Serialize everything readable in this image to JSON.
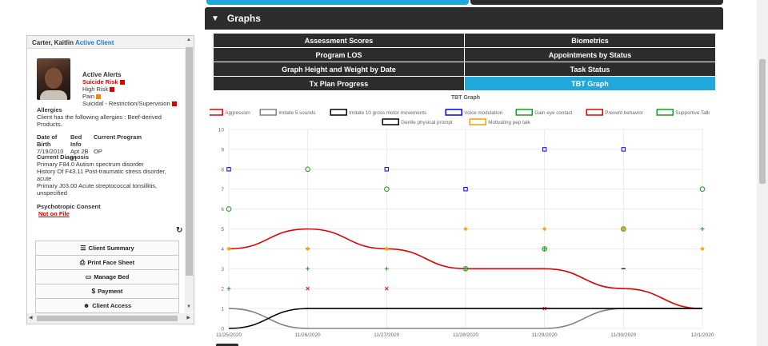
{
  "graphs_header": {
    "title": "Graphs"
  },
  "tabs": [
    {
      "label": "Assessment Scores",
      "active": false
    },
    {
      "label": "Biometrics",
      "active": false
    },
    {
      "label": "Program LOS",
      "active": false
    },
    {
      "label": "Appointments by Status",
      "active": false
    },
    {
      "label": "Graph Height and Weight by Date",
      "active": false
    },
    {
      "label": "Task Status",
      "active": false
    },
    {
      "label": "Tx Plan Progress",
      "active": false
    },
    {
      "label": "TBT Graph",
      "active": true
    }
  ],
  "client": {
    "name": "Carter, Kaitlin",
    "status": "Active Client",
    "alerts_title": "Active Alerts",
    "alerts": [
      {
        "text": "Suicide Risk",
        "color": "#e00000",
        "bold_red": true
      },
      {
        "text": "High Risk",
        "color": "#e00000",
        "bold_red": false
      },
      {
        "text": "Pain",
        "color": "#f28c00",
        "bold_red": false
      },
      {
        "text": "Suicidal - Restriction/Supervision",
        "color": "#e00000",
        "bold_red": false
      }
    ],
    "allergies_label": "Allergies",
    "allergies_text": "Client has the following allergies : Beef-derived Products.",
    "dob_label": "Date of Birth",
    "bed_label": "Bed Info",
    "program_label": "Current Program",
    "dob": "7/19/2010",
    "bed": "Apt 2B 01",
    "program": "OP",
    "diagnosis_label": "Current Diagnosis",
    "diagnosis": [
      "Primary F84.0 Autism spectrum disorder",
      "History Of F43.11 Post-traumatic stress disorder, acute",
      "Primary J03.00 Acute streptococcal tonsillitis, unspecified"
    ],
    "consent_label": "Psychotropic Consent",
    "consent_value": "Not on File"
  },
  "actions": [
    {
      "label": "Client Summary",
      "icon": "list-icon",
      "glyph": "☰"
    },
    {
      "label": "Print Face Sheet",
      "icon": "print-icon",
      "glyph": "⎙"
    },
    {
      "label": "Manage Bed",
      "icon": "bed-icon",
      "glyph": "▭"
    },
    {
      "label": "Payment",
      "icon": "dollar-icon",
      "glyph": "$"
    },
    {
      "label": "Client Access",
      "icon": "user-key-icon",
      "glyph": "☻"
    }
  ],
  "chart_data": {
    "type": "line",
    "title": "TBT Graph",
    "x": [
      "11/25/2020",
      "11/26/2020",
      "11/27/2020",
      "11/28/2020",
      "11/29/2020",
      "11/30/2020",
      "12/1/2020"
    ],
    "ylim": [
      0,
      10
    ],
    "yticks": [
      0,
      1,
      2,
      3,
      4,
      5,
      6,
      7,
      8,
      9,
      10
    ],
    "grid": true,
    "legend_position": "top",
    "series": [
      {
        "name": "Aggression",
        "color": "#e00000",
        "type": "line",
        "values": [
          4,
          5,
          4,
          3,
          3,
          2,
          1
        ]
      },
      {
        "name": "Imitate 5 sounds",
        "color": "#808080",
        "type": "line",
        "values": [
          1,
          0,
          0,
          0,
          0,
          1,
          1
        ]
      },
      {
        "name": "Imitate 10 gross motor movements",
        "color": "#000000",
        "type": "line",
        "values": [
          0,
          1,
          1,
          1,
          1,
          1,
          1
        ]
      },
      {
        "name": "Voice modulation",
        "color": "#0000ee",
        "type": "points",
        "marker": "square",
        "values": [
          8,
          null,
          8,
          7,
          9,
          9,
          null
        ]
      },
      {
        "name": "Gain eye contact",
        "color": "#1a9a1a",
        "type": "points",
        "marker": "circle",
        "values": [
          6,
          8,
          7,
          3,
          4,
          5,
          7
        ]
      },
      {
        "name": "Prevent behavior",
        "color": "#e00000",
        "type": "points",
        "marker": "cross",
        "values": [
          null,
          2,
          2,
          null,
          1,
          null,
          null
        ]
      },
      {
        "name": "Supportive Talk",
        "color": "#1a9a1a",
        "type": "points",
        "marker": "plus",
        "values": [
          2,
          3,
          3,
          3,
          4,
          5,
          5
        ]
      },
      {
        "name": "Gentle physical prompt",
        "color": "#000000",
        "type": "points",
        "marker": "dash",
        "values": [
          null,
          4,
          null,
          null,
          1,
          3,
          null
        ]
      },
      {
        "name": "Motivating pep talk",
        "color": "#f5a000",
        "type": "points",
        "marker": "star",
        "values": [
          4,
          4,
          4,
          5,
          5,
          5,
          4
        ]
      }
    ]
  }
}
